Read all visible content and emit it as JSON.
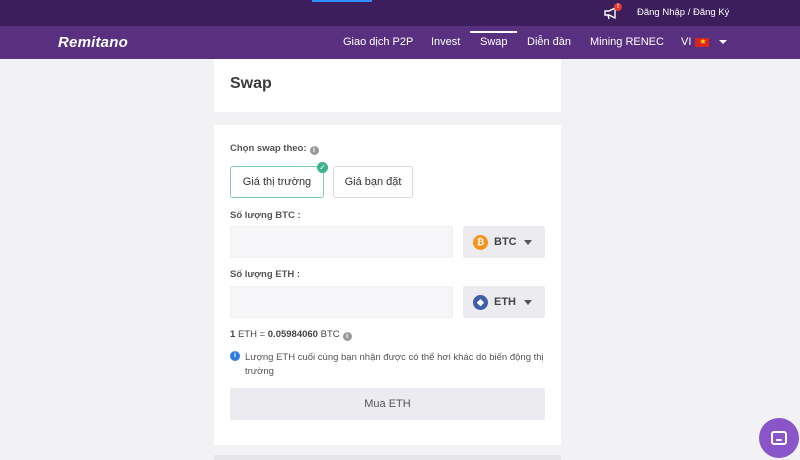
{
  "topbar": {
    "notification_badge": "!",
    "auth_link": "Đăng Nhập / Đăng Ký"
  },
  "navbar": {
    "logo": "Remitano",
    "items": [
      {
        "label": "Giao dịch P2P"
      },
      {
        "label": "Invest"
      },
      {
        "label": "Swap"
      },
      {
        "label": "Diễn đàn"
      },
      {
        "label": "Mining RENEC"
      }
    ],
    "active_item": "Swap",
    "language": "VI"
  },
  "page": {
    "title": "Swap"
  },
  "swap_form": {
    "mode_label": "Chọn swap theo:",
    "mode_options": [
      "Giá thị trường",
      "Giá bạn đặt"
    ],
    "selected_mode": "Giá thị trường",
    "from_label": "Số lượng BTC :",
    "from_value": "",
    "from_coin": "BTC",
    "to_label": "Số lượng ETH :",
    "to_value": "",
    "to_coin": "ETH",
    "rate": {
      "lhs_amount": "1",
      "lhs_unit": "ETH =",
      "rhs_amount": "0.05984060",
      "rhs_unit": "BTC"
    },
    "note": "Lượng ETH cuối cùng bạn nhận được có thể hơi khác do biến động thị trường",
    "submit_label": "Mua ETH"
  },
  "colors": {
    "topbar": "#3c1e5c",
    "navbar": "#58307f",
    "btc": "#f7931a",
    "eth": "#3c5fa8",
    "check": "#3cb48a",
    "info": "#2f7de1",
    "chat": "#8a55c8"
  },
  "icons": {
    "bell": "megaphone-icon",
    "check": "check-icon",
    "info": "info-icon",
    "caret": "chevron-down-icon",
    "chat": "chat-icon"
  }
}
